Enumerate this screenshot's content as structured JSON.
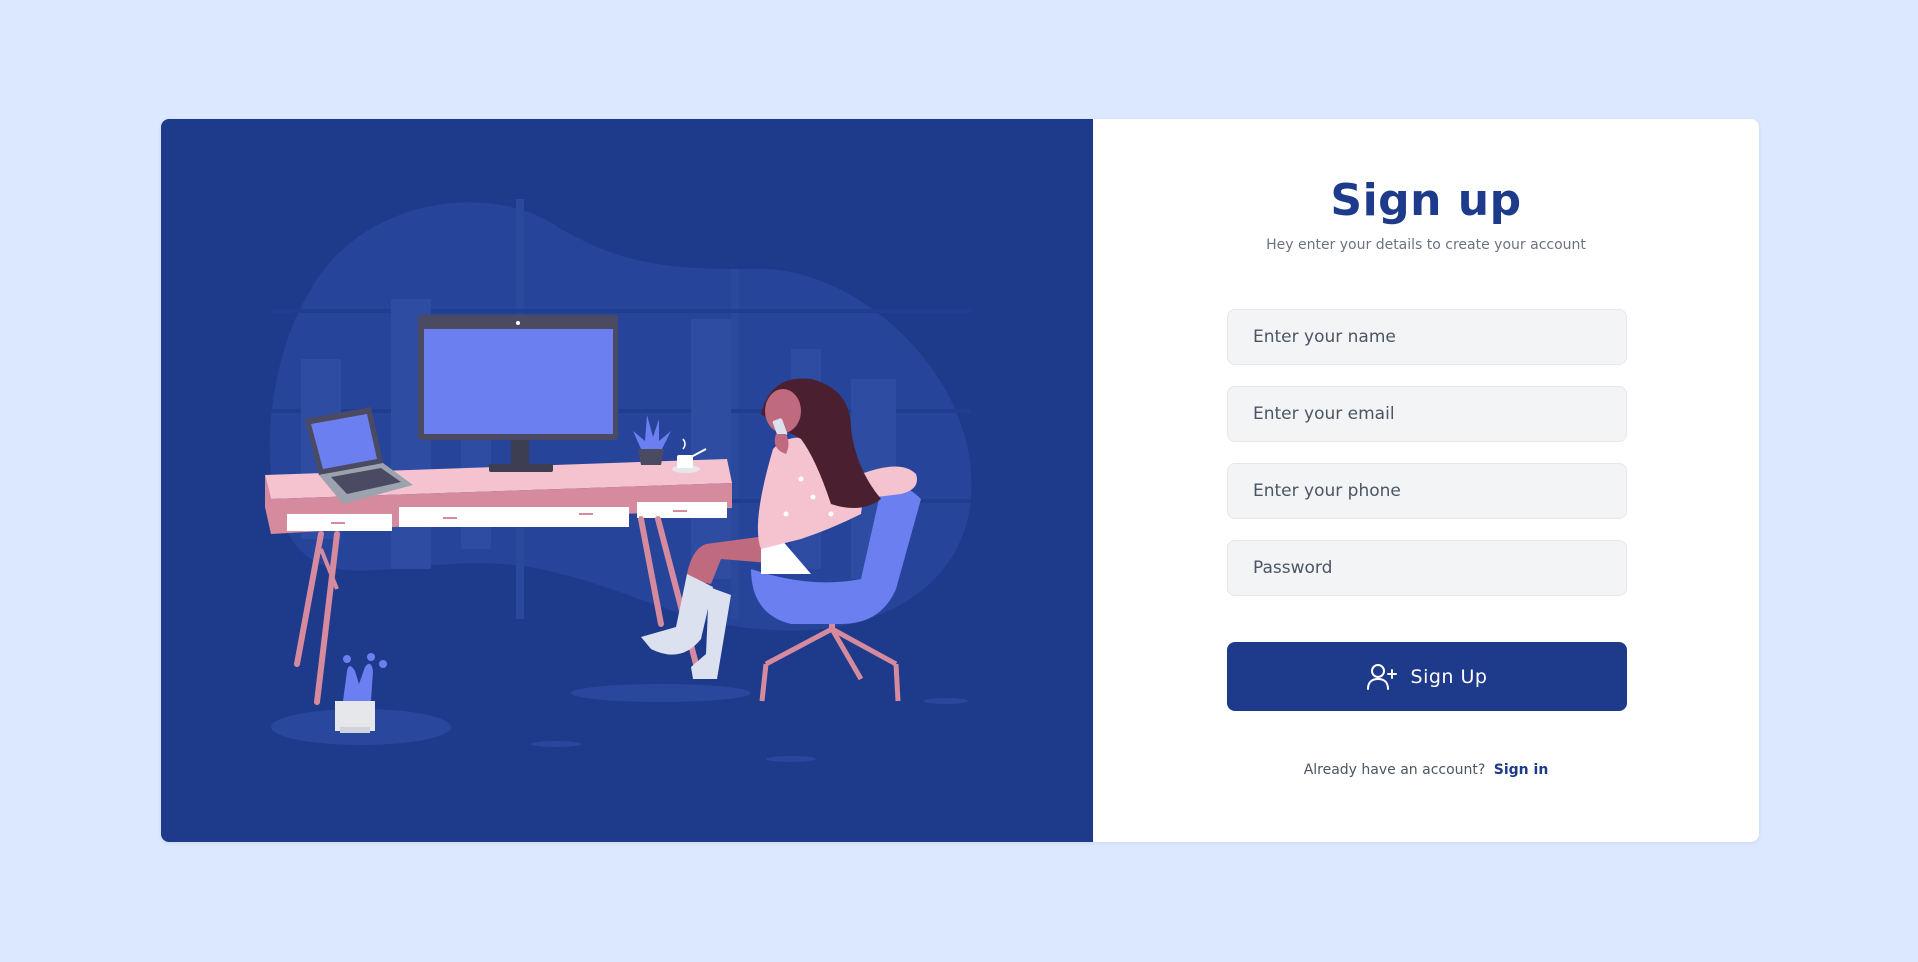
{
  "form": {
    "title": "Sign up",
    "subtitle": "Hey enter your details to create your account",
    "fields": [
      {
        "placeholder": "Enter your name",
        "value": ""
      },
      {
        "placeholder": "Enter your email",
        "value": ""
      },
      {
        "placeholder": "Enter your phone",
        "value": ""
      },
      {
        "placeholder": "Password",
        "value": ""
      }
    ],
    "submit_label": "Sign Up",
    "submit_icon": "user-plus-icon",
    "footer_text": "Already have an account?",
    "signin_link": "Sign in"
  },
  "colors": {
    "page_background": "#dbe8ff",
    "brand": "#1e3a8a",
    "card_background": "#ffffff",
    "input_background": "#f3f4f6",
    "illustration_accent": "#6b7ff0",
    "illustration_pink": "#f5c2cf"
  }
}
